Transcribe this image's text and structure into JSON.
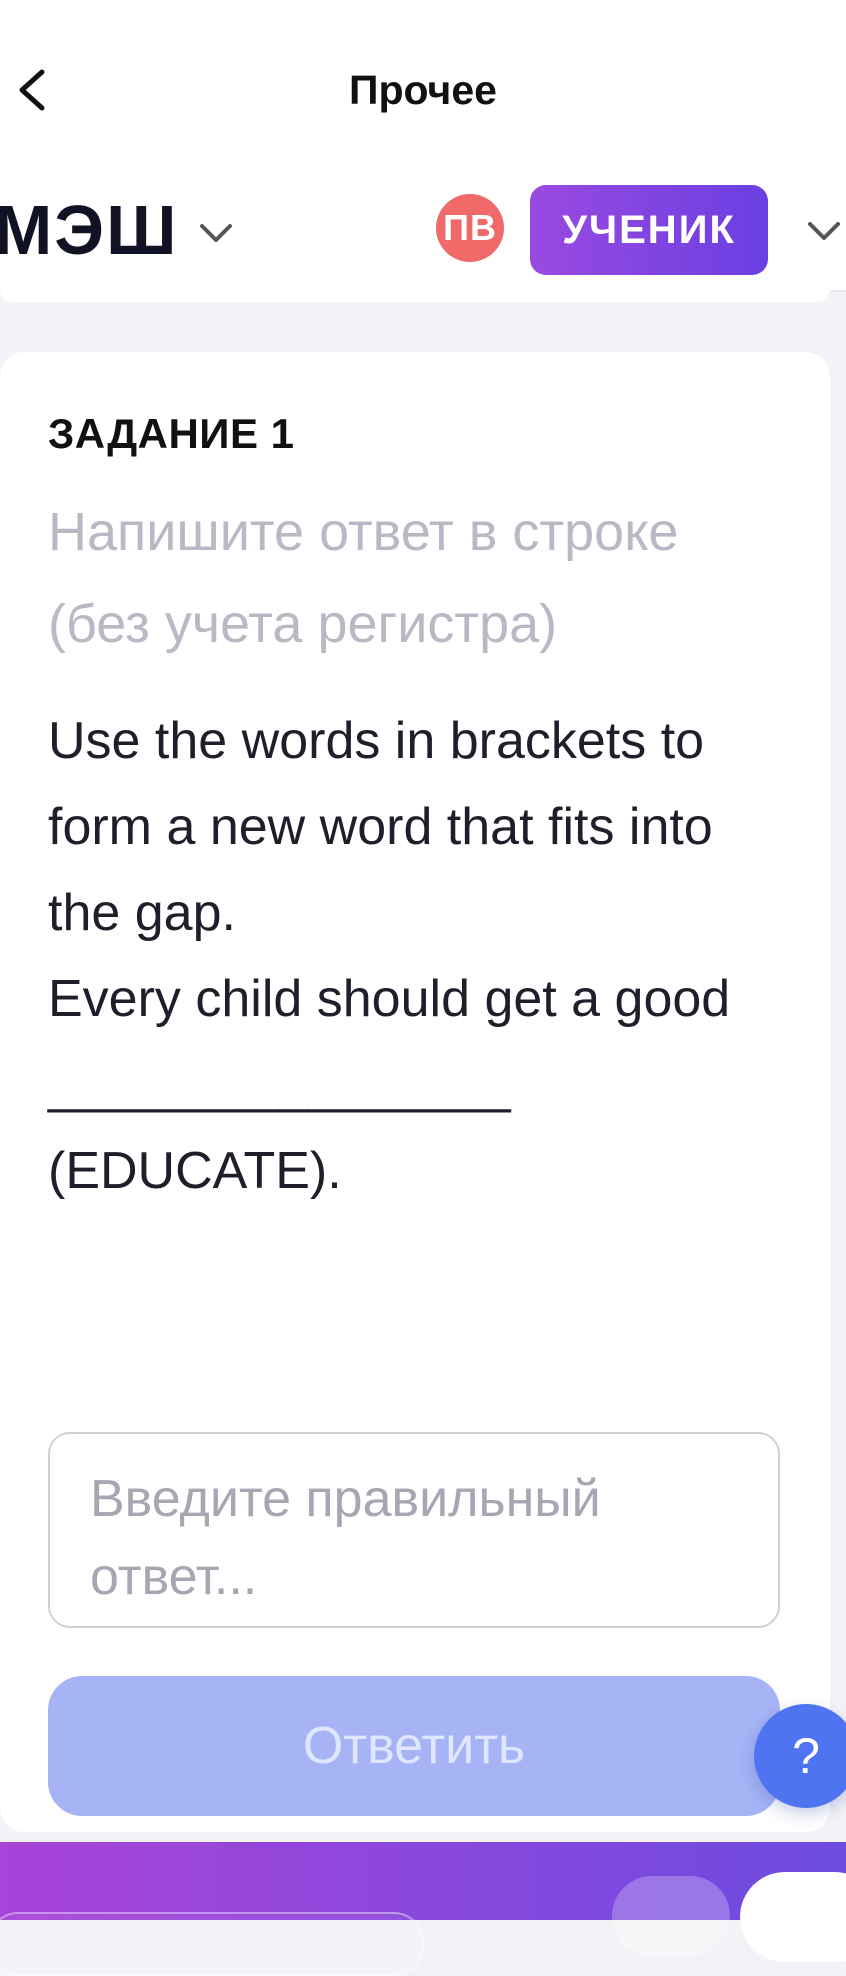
{
  "header": {
    "title": "Прочее"
  },
  "brand": {
    "logo_text": "МЭШ",
    "avatar_initials": "ПВ",
    "role_label": "УЧЕНИК"
  },
  "task": {
    "number_label": "ЗАДАНИЕ 1",
    "instruction": "Напишите ответ в строке (без учета регистра)",
    "text": "Use the words in brackets to form a new word that fits into the gap.\nEvery child should get a good ________________\n(EDUCATE).",
    "input_placeholder": "Введите правильный ответ...",
    "submit_label": "Ответить"
  },
  "help": {
    "label": "?"
  },
  "colors": {
    "role_badge": "#7a44e0",
    "avatar": "#f06a6a",
    "submit_disabled": "#a6b3f5",
    "help_fab": "#4f74f2",
    "bottom_bar_start": "#a844d8",
    "bottom_bar_end": "#6d4be0"
  },
  "icons": {
    "back": "chevron-left-icon",
    "brand_dropdown": "chevron-down-icon",
    "role_dropdown": "chevron-down-icon"
  }
}
